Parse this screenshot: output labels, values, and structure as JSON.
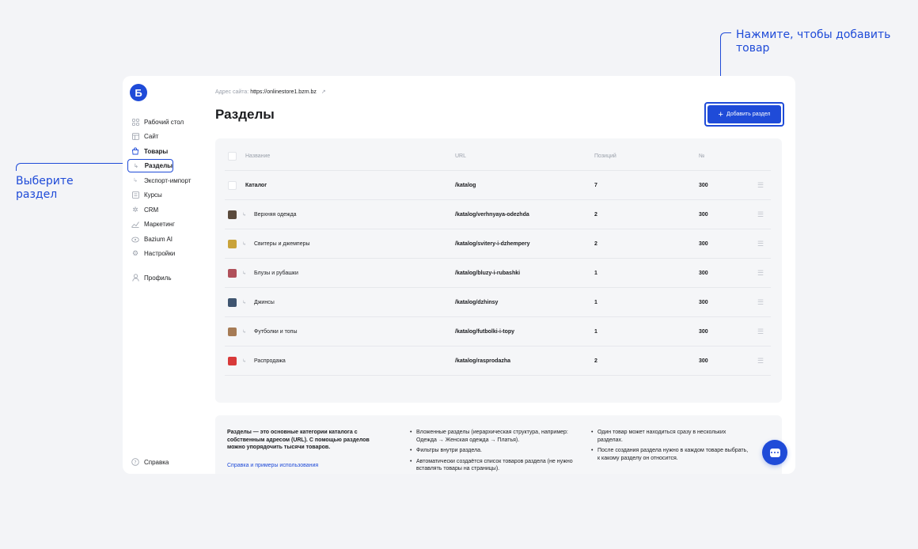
{
  "callouts": {
    "add": "Нажмите, чтобы добавить товар",
    "select": "Выберите раздел"
  },
  "logo": "Б",
  "sidebar": {
    "items": [
      {
        "label": "Рабочий стол",
        "icon": "grid-icon"
      },
      {
        "label": "Сайт",
        "icon": "layout-icon"
      },
      {
        "label": "Товары",
        "icon": "bag-icon"
      },
      {
        "label": "Разделы",
        "icon": "sub-arrow-icon"
      },
      {
        "label": "Экспорт-импорт",
        "icon": "sub-arrow-icon"
      },
      {
        "label": "Курсы",
        "icon": "book-icon"
      },
      {
        "label": "CRM",
        "icon": "crm-icon"
      },
      {
        "label": "Маркетинг",
        "icon": "chart-icon"
      },
      {
        "label": "Bazium AI",
        "icon": "ai-icon"
      },
      {
        "label": "Настройки",
        "icon": "gear-icon"
      },
      {
        "label": "Профиль",
        "icon": "user-icon"
      }
    ],
    "help": "Справка"
  },
  "header": {
    "address_label": "Адрес сайта:",
    "address_url": "https://onlinestore1.bzm.bz",
    "title": "Разделы",
    "add_button": "Добавить раздел"
  },
  "table": {
    "columns": [
      "Название",
      "URL",
      "Позиций",
      "№"
    ],
    "rows": [
      {
        "name": "Каталог",
        "url": "/katalog",
        "count": "7",
        "num": "300"
      },
      {
        "name": "Верхняя одежда",
        "url": "/katalog/verhnyaya-odezhda",
        "count": "2",
        "num": "300"
      },
      {
        "name": "Свитеры и джемперы",
        "url": "/katalog/svitery-i-dzhempery",
        "count": "2",
        "num": "300"
      },
      {
        "name": "Блузы и рубашки",
        "url": "/katalog/bluzy-i-rubashki",
        "count": "1",
        "num": "300"
      },
      {
        "name": "Джинсы",
        "url": "/katalog/dzhinsy",
        "count": "1",
        "num": "300"
      },
      {
        "name": "Футболки и топы",
        "url": "/katalog/futbolki-i-topy",
        "count": "1",
        "num": "300"
      },
      {
        "name": "Распродажа",
        "url": "/katalog/rasprodazha",
        "count": "2",
        "num": "300"
      }
    ]
  },
  "info": {
    "intro": "Разделы — это основные категории каталога с собственным адресом (URL). С помощью разделов можно упорядочить тысячи товаров.",
    "link": "Справка и примеры использования",
    "bullets_col2": [
      "Вложенные разделы (иерархическая структура, например: Одежда → Женская одежда → Платья).",
      "Фильтры внутри раздела.",
      "Автоматически создаётся список товаров раздела (не нужно вставлять товары на страницы)."
    ],
    "bullets_col3": [
      "Один товар может находиться сразу в нескольких разделах.",
      "После создания раздела нужно в каждом товаре выбрать, к какому разделу он относится."
    ]
  },
  "colors": {
    "accent": "#1f4bd8",
    "thumbs": [
      "#5a4a3c",
      "#c9a33a",
      "#b0505a",
      "#3f5570",
      "#a67b55",
      "#d83a3a"
    ]
  }
}
